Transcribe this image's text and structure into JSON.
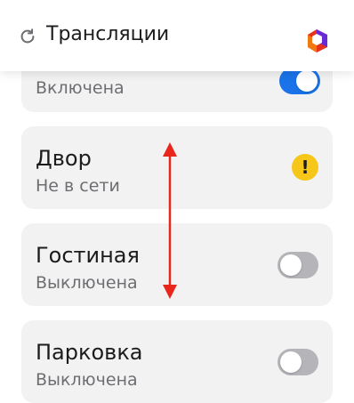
{
  "header": {
    "title": "Трансляции",
    "refresh_icon": "refresh-icon",
    "logo_icon": "app-logo-icon"
  },
  "cameras": [
    {
      "name": "",
      "status": "Включена",
      "control": "toggle",
      "toggle_on": true
    },
    {
      "name": "Двор",
      "status": "Не в сети",
      "control": "warning",
      "warning_symbol": "!"
    },
    {
      "name": "Гостиная",
      "status": "Выключена",
      "control": "toggle",
      "toggle_on": false
    },
    {
      "name": "Парковка",
      "status": "Выключена",
      "control": "toggle",
      "toggle_on": false
    }
  ],
  "colors": {
    "toggle_on": "#1a73e8",
    "toggle_off": "#b5b5b9",
    "warning": "#f6c619",
    "annotation_arrow": "#e8261a"
  }
}
